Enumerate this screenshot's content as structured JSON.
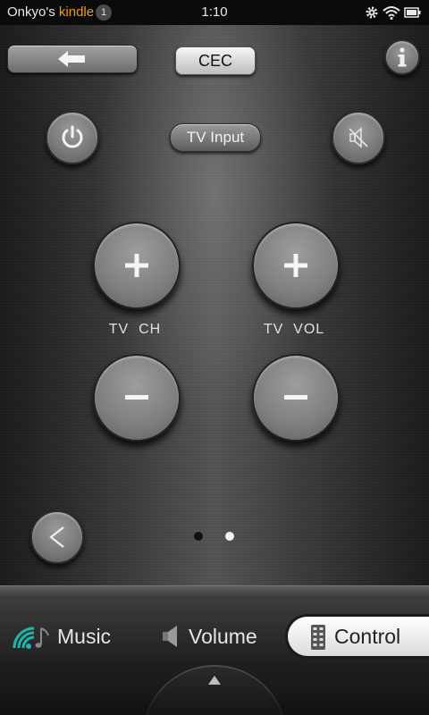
{
  "status_bar": {
    "app_name": "Onkyo's",
    "brand": "kindle",
    "notification_count": "1",
    "time": "1:10",
    "icons": [
      "gear-icon",
      "wifi-icon",
      "battery-icon"
    ]
  },
  "top_controls": {
    "cec_label": "CEC",
    "tv_input_label": "TV Input",
    "info_glyph": "i"
  },
  "groups": {
    "channel_label": "TV  CH",
    "volume_label": "TV  VOL"
  },
  "pagination": {
    "current_page": 2,
    "total_pages": 2
  },
  "bottom_nav": {
    "music_label": "Music",
    "volume_label": "Volume",
    "control_label": "Control",
    "active": "Control"
  },
  "colors": {
    "kindle_orange": "#f39a1e",
    "music_icon_teal": "#1fb5ad",
    "active_tab_bg": "#ffffff"
  }
}
